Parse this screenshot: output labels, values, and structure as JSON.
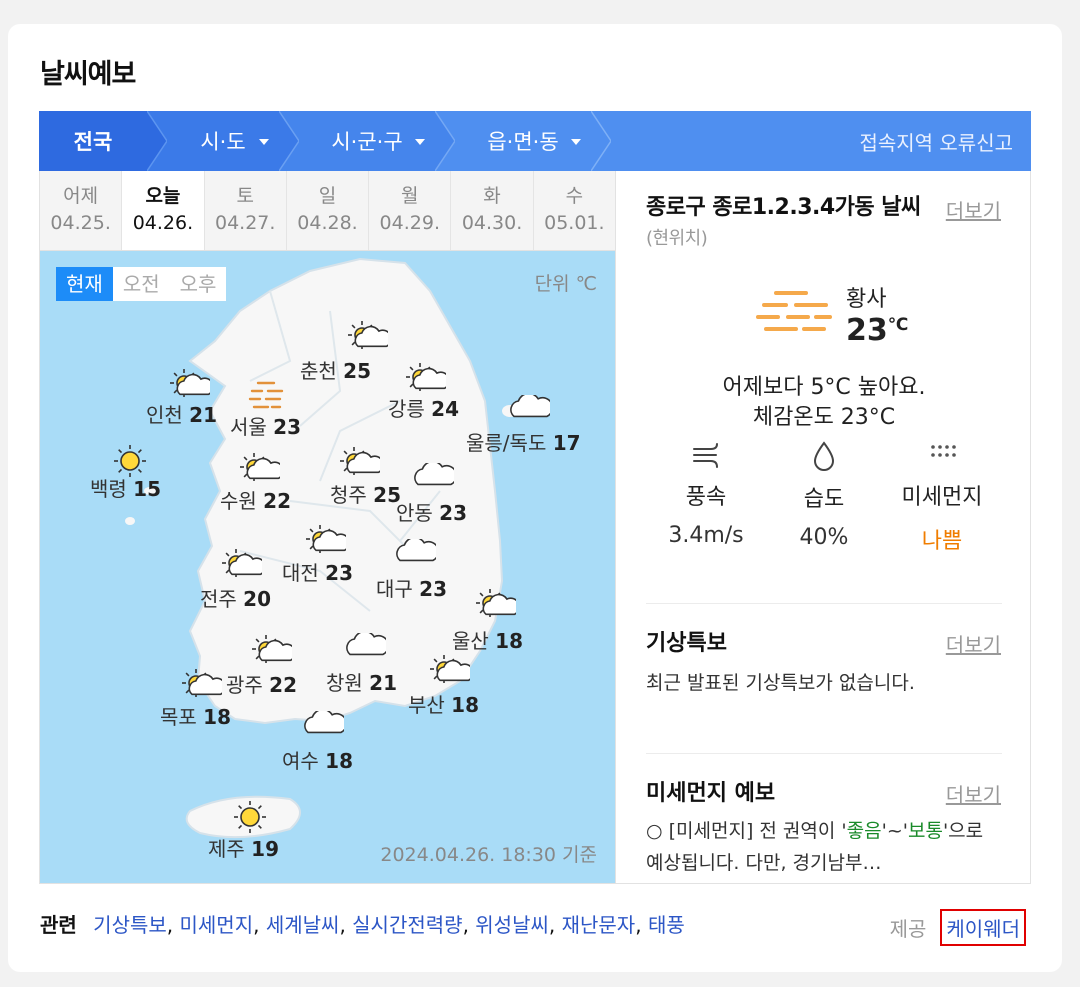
{
  "widget": {
    "title": "날씨예보"
  },
  "nav": {
    "all": "전국",
    "sido": "시·도",
    "sigungu": "시·군·구",
    "eupmyeondong": "읍·면·동",
    "report": "접속지역 오류신고"
  },
  "days": [
    {
      "name": "어제",
      "date": "04.25."
    },
    {
      "name": "오늘",
      "date": "04.26."
    },
    {
      "name": "토",
      "date": "04.27."
    },
    {
      "name": "일",
      "date": "04.28."
    },
    {
      "name": "월",
      "date": "04.29."
    },
    {
      "name": "화",
      "date": "04.30."
    },
    {
      "name": "수",
      "date": "05.01."
    }
  ],
  "map": {
    "tabs": [
      "현재",
      "오전",
      "오후"
    ],
    "unit": "단위 ℃",
    "base_time": "2024.04.26. 18:30 기준",
    "cities": [
      {
        "name": "춘천",
        "temp": "25",
        "icon": "partly-cloudy-icon"
      },
      {
        "name": "인천",
        "temp": "21",
        "icon": "partly-cloudy-icon"
      },
      {
        "name": "서울",
        "temp": "23",
        "icon": "yellow-dust-icon"
      },
      {
        "name": "강릉",
        "temp": "24",
        "icon": "partly-cloudy-icon"
      },
      {
        "name": "울릉/독도",
        "temp": "17",
        "icon": "cloud-icon"
      },
      {
        "name": "백령",
        "temp": "15",
        "icon": "sun-icon"
      },
      {
        "name": "수원",
        "temp": "22",
        "icon": "partly-cloudy-icon"
      },
      {
        "name": "청주",
        "temp": "25",
        "icon": "partly-cloudy-icon"
      },
      {
        "name": "안동",
        "temp": "23",
        "icon": "cloud-icon"
      },
      {
        "name": "대전",
        "temp": "23",
        "icon": "partly-cloudy-icon"
      },
      {
        "name": "대구",
        "temp": "23",
        "icon": "cloud-icon"
      },
      {
        "name": "전주",
        "temp": "20",
        "icon": "partly-cloudy-icon"
      },
      {
        "name": "울산",
        "temp": "18",
        "icon": "partly-cloudy-icon"
      },
      {
        "name": "광주",
        "temp": "22",
        "icon": "partly-cloudy-icon"
      },
      {
        "name": "창원",
        "temp": "21",
        "icon": "cloud-icon"
      },
      {
        "name": "부산",
        "temp": "18",
        "icon": "partly-cloudy-icon"
      },
      {
        "name": "목포",
        "temp": "18",
        "icon": "partly-cloudy-icon"
      },
      {
        "name": "여수",
        "temp": "18",
        "icon": "cloud-icon"
      },
      {
        "name": "제주",
        "temp": "19",
        "icon": "sun-icon"
      }
    ]
  },
  "current": {
    "location": "종로구 종로1.2.3.4가동 날씨",
    "location_sub": "(현위치)",
    "more": "더보기",
    "condition": "황사",
    "temp": "23",
    "temp_unit": "℃",
    "compare": "어제보다 5°C 높아요.",
    "feels": "체감온도 23°C",
    "wind_label": "풍속",
    "wind_value": "3.4m/s",
    "humidity_label": "습도",
    "humidity_value": "40%",
    "dust_label": "미세먼지",
    "dust_value": "나쁨",
    "icon_colors": {
      "dust": "#f5a94b",
      "bad": "#f07d00"
    }
  },
  "warning": {
    "title": "기상특보",
    "more": "더보기",
    "text": "최근 발표된 기상특보가 없습니다."
  },
  "dust_forecast": {
    "title": "미세먼지 예보",
    "more": "더보기",
    "text_before": "○ [미세먼지] 전 권역이 '",
    "good": "좋음",
    "mid": "'~'",
    "normal": "보통",
    "text_after": "'으로 예상됩니다. 다만, 경기남부…"
  },
  "footer": {
    "related_label": "관련",
    "links": [
      "기상특보",
      "미세먼지",
      "세계날씨",
      "실시간전력량",
      "위성날씨",
      "재난문자",
      "태풍"
    ],
    "provider_label": "제공",
    "provider": "케이웨더"
  }
}
